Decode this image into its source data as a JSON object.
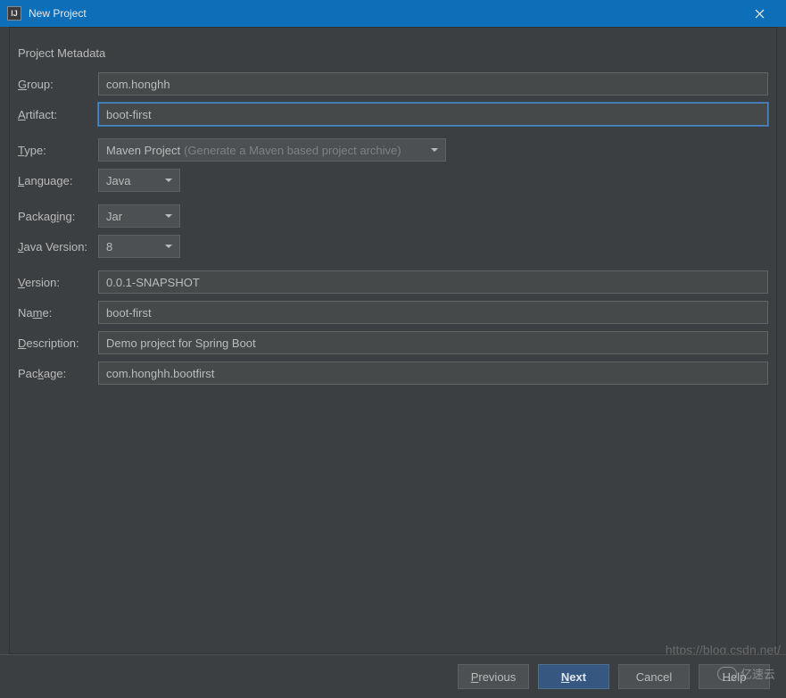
{
  "window": {
    "title": "New Project",
    "icon_text": "IJ"
  },
  "section_title": "Project Metadata",
  "fields": {
    "group": {
      "label_pre": "",
      "label_u": "G",
      "label_post": "roup:",
      "value": "com.honghh"
    },
    "artifact": {
      "label_pre": "",
      "label_u": "A",
      "label_post": "rtifact:",
      "value": "boot-first"
    },
    "type": {
      "label_pre": "",
      "label_u": "T",
      "label_post": "ype:",
      "value": "Maven Project",
      "hint": "(Generate a Maven based project archive)"
    },
    "language": {
      "label_pre": "",
      "label_u": "L",
      "label_post": "anguage:",
      "value": "Java"
    },
    "packaging": {
      "label_pre": "Packag",
      "label_u": "i",
      "label_post": "ng:",
      "value": "Jar"
    },
    "javaVersion": {
      "label_pre": "",
      "label_u": "J",
      "label_post": "ava Version:",
      "value": "8"
    },
    "version": {
      "label_pre": "",
      "label_u": "V",
      "label_post": "ersion:",
      "value": "0.0.1-SNAPSHOT"
    },
    "name": {
      "label_pre": "Na",
      "label_u": "m",
      "label_post": "e:",
      "value": "boot-first"
    },
    "description": {
      "label_pre": "",
      "label_u": "D",
      "label_post": "escription:",
      "value": "Demo project for Spring Boot"
    },
    "package": {
      "label_pre": "Pac",
      "label_u": "k",
      "label_post": "age:",
      "value": "com.honghh.bootfirst"
    }
  },
  "buttons": {
    "previous": {
      "pre": "",
      "u": "P",
      "post": "revious"
    },
    "next": {
      "pre": "",
      "u": "N",
      "post": "ext"
    },
    "cancel": "Cancel",
    "help": "Help"
  },
  "watermark": {
    "url": "https://blog.csdn.net/",
    "brand": "亿速云"
  }
}
